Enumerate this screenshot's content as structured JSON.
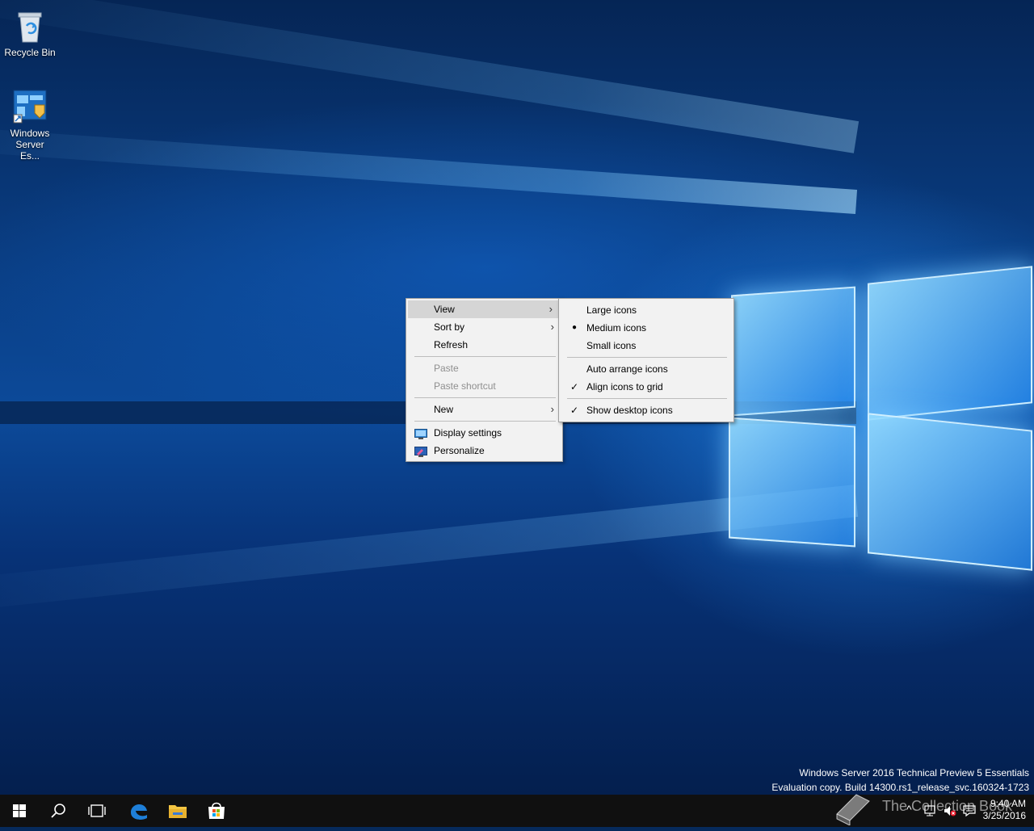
{
  "desktop": {
    "icons": [
      {
        "label": "Recycle Bin",
        "icon": "recycle-bin-icon"
      },
      {
        "label": "Windows Server Es...",
        "icon": "windows-server-essentials-icon"
      }
    ]
  },
  "context_menu": {
    "items": [
      {
        "label": "View",
        "submenu": true,
        "highlighted": true
      },
      {
        "label": "Sort by",
        "submenu": true
      },
      {
        "label": "Refresh"
      },
      {
        "label": "Paste",
        "disabled": true
      },
      {
        "label": "Paste shortcut",
        "disabled": true
      },
      {
        "label": "New",
        "submenu": true
      },
      {
        "label": "Display settings",
        "icon": "display-settings-icon"
      },
      {
        "label": "Personalize",
        "icon": "personalize-icon"
      }
    ],
    "arrow_glyph": ">"
  },
  "view_submenu": {
    "items": [
      {
        "label": "Large icons"
      },
      {
        "label": "Medium icons",
        "mark": "●"
      },
      {
        "label": "Small icons"
      },
      {
        "label": "Auto arrange icons"
      },
      {
        "label": "Align icons to grid",
        "mark": "✓"
      },
      {
        "label": "Show desktop icons",
        "mark": "✓"
      }
    ]
  },
  "watermark": {
    "line1": "Windows Server 2016 Technical Preview 5 Essentials",
    "line2": "Evaluation copy. Build 14300.rs1_release_svc.160324-1723"
  },
  "taskbar": {
    "buttons": [
      "start-icon",
      "search-icon",
      "task-view-icon",
      "edge-icon",
      "file-explorer-icon",
      "store-icon"
    ],
    "tray": {
      "show_hidden": "^",
      "time": "9:40 AM",
      "date": "3/25/2016"
    }
  },
  "overlay_watermark": "The Collection Book",
  "colors": {
    "taskbar": "#101010",
    "menu_bg": "#f2f2f2",
    "menu_highlight": "#d5d5d5",
    "disabled_text": "#8f8f8f",
    "edge_blue": "#1e7fd8",
    "explorer_yellow": "#f4c542"
  }
}
